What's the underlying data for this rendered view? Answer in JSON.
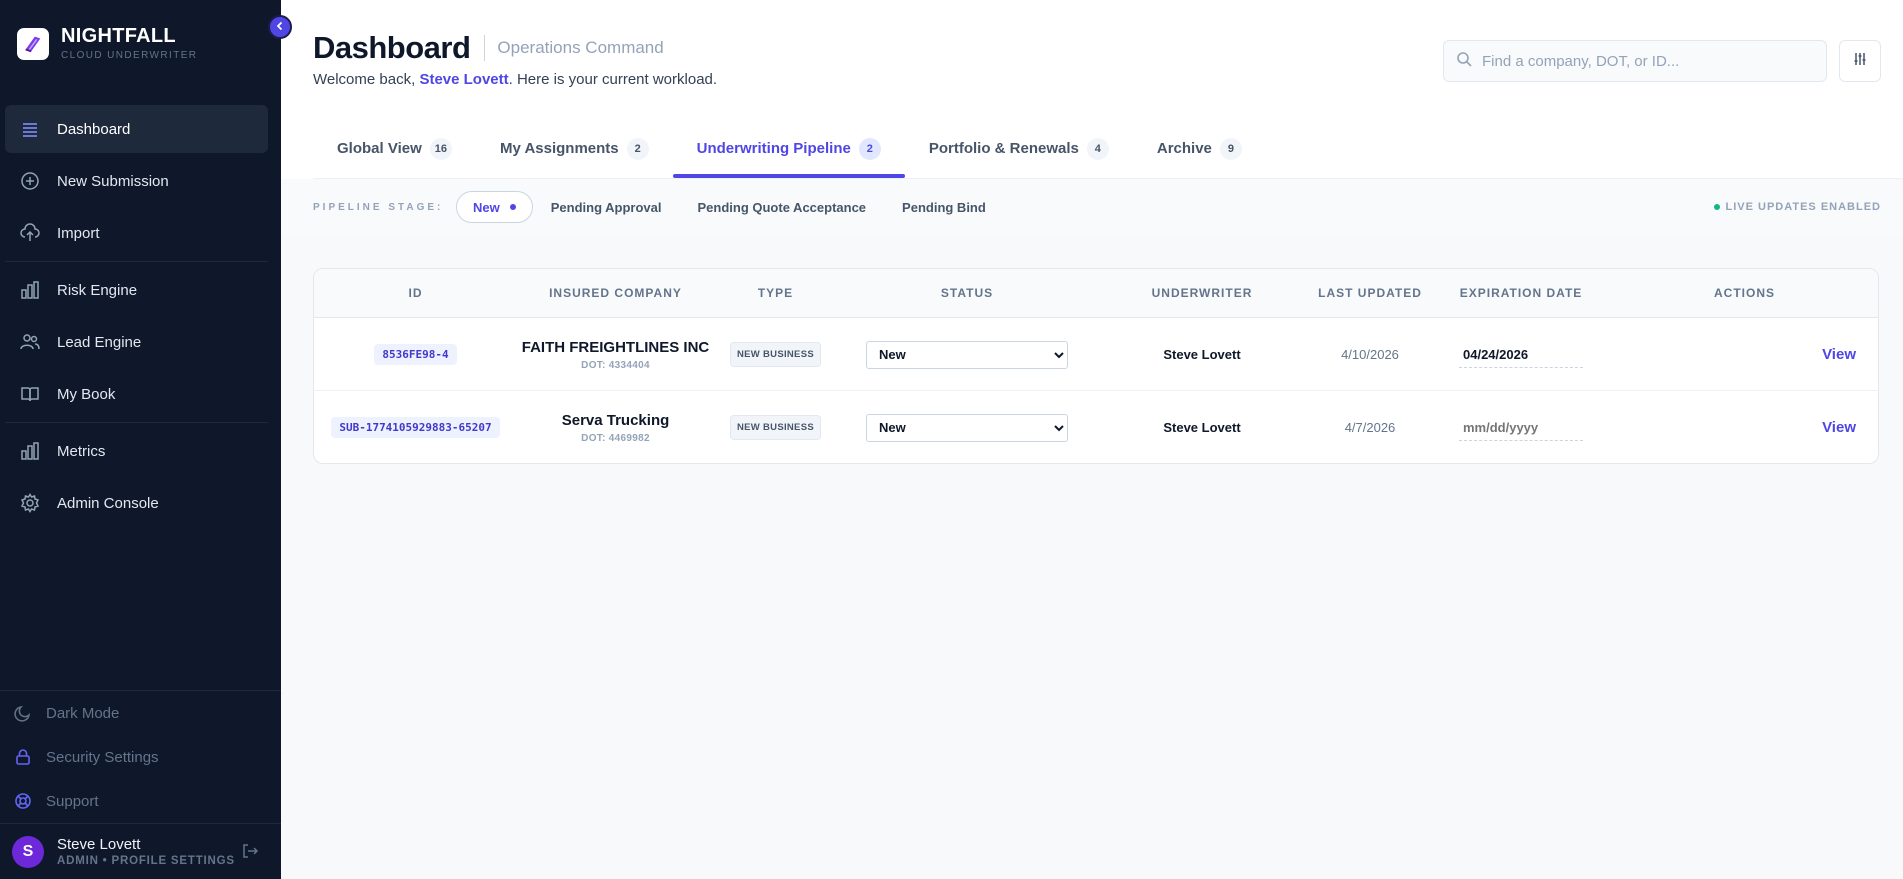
{
  "brand": {
    "name": "NIGHTFALL",
    "subtitle": "CLOUD UNDERWRITER"
  },
  "sidebar": {
    "items": [
      {
        "label": "Dashboard",
        "icon": "list-icon",
        "active": true
      },
      {
        "label": "New Submission",
        "icon": "plus-circle-icon"
      },
      {
        "label": "Import",
        "icon": "upload-cloud-icon"
      },
      {
        "label": "Risk Engine",
        "icon": "bar-chart-icon"
      },
      {
        "label": "Lead Engine",
        "icon": "users-icon"
      },
      {
        "label": "My Book",
        "icon": "book-open-icon"
      },
      {
        "label": "Metrics",
        "icon": "bar-chart-icon"
      },
      {
        "label": "Admin Console",
        "icon": "gear-icon"
      }
    ],
    "bottom": {
      "dark_mode": "Dark Mode",
      "security": "Security Settings",
      "support": "Support"
    },
    "user": {
      "initial": "S",
      "name": "Steve Lovett",
      "role": "ADMIN • PROFILE SETTINGS"
    }
  },
  "header": {
    "title": "Dashboard",
    "subtitle": "Operations Command",
    "welcome_prefix": "Welcome back, ",
    "welcome_name": "Steve Lovett",
    "welcome_suffix": ". Here is your current workload.",
    "search_placeholder": "Find a company, DOT, or ID..."
  },
  "tabs": [
    {
      "label": "Global View",
      "count": "16"
    },
    {
      "label": "My Assignments",
      "count": "2"
    },
    {
      "label": "Underwriting Pipeline",
      "count": "2",
      "active": true
    },
    {
      "label": "Portfolio & Renewals",
      "count": "4"
    },
    {
      "label": "Archive",
      "count": "9"
    }
  ],
  "pipeline": {
    "label": "PIPELINE STAGE:",
    "stages": [
      "New",
      "Pending Approval",
      "Pending Quote Acceptance",
      "Pending Bind"
    ],
    "active_stage": "New",
    "live_label": "LIVE UPDATES ENABLED"
  },
  "table": {
    "headers": [
      "ID",
      "INSURED COMPANY",
      "TYPE",
      "STATUS",
      "UNDERWRITER",
      "LAST UPDATED",
      "EXPIRATION DATE",
      "ACTIONS"
    ],
    "rows": [
      {
        "id": "8536FE98-4",
        "company": "FAITH FREIGHTLINES INC",
        "dot": "DOT: 4334404",
        "type": "NEW BUSINESS",
        "status": "New",
        "underwriter": "Steve Lovett",
        "last_updated": "4/10/2026",
        "expiration": "04/24/2026",
        "action": "View"
      },
      {
        "id": "SUB-1774105929883-65207",
        "company": "Serva Trucking",
        "dot": "DOT: 4469982",
        "type": "NEW BUSINESS",
        "status": "New",
        "underwriter": "Steve Lovett",
        "last_updated": "4/7/2026",
        "expiration": "mm/dd/yyyy",
        "action": "View"
      }
    ]
  },
  "colors": {
    "accent": "#4f46e5",
    "sidebar_bg": "#0f172a",
    "live_dot": "#10b981"
  }
}
